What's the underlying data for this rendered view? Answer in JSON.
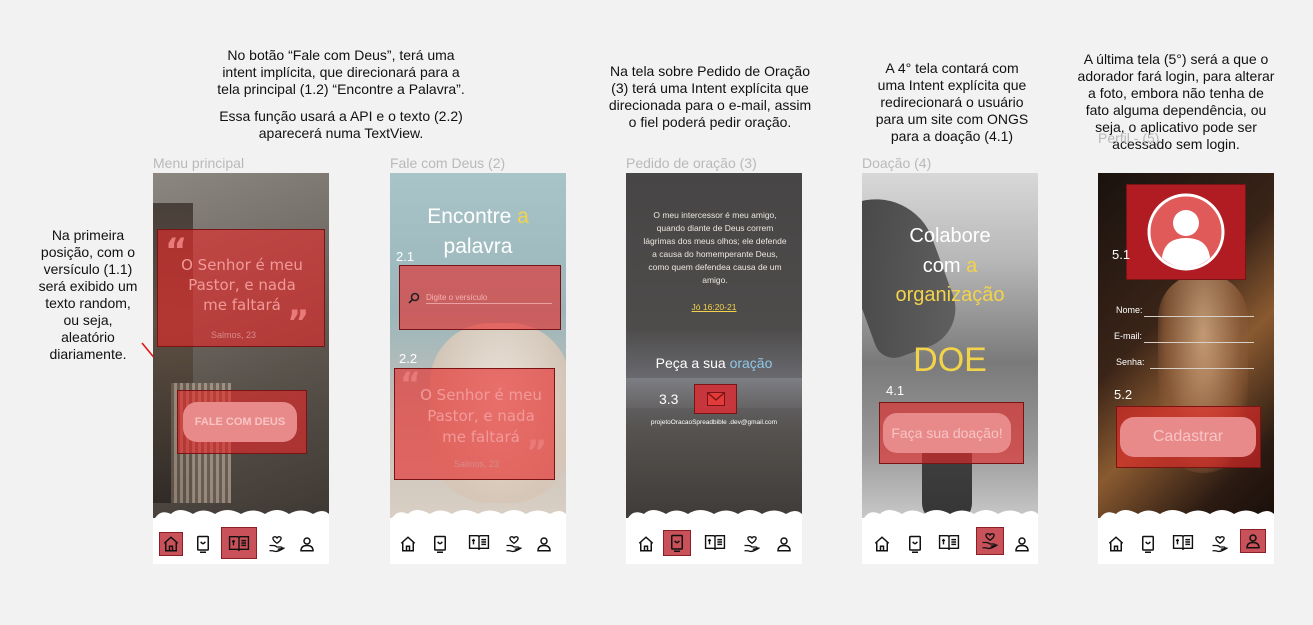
{
  "notes": {
    "top_1": "No botão “Fale com Deus”, terá uma\nintent   implícita, que direcionará para a\ntela principal (1.2) “Encontre a Palavra”.",
    "top_1b": "Essa função usará a API e o texto (2.2)\naparecerá numa TextView.",
    "top_3": "Na tela sobre Pedido de Oração\n(3) terá uma Intent explícita que\ndirecionada para o e-mail, assim\no fiel poderá pedir oração.",
    "top_4": "A 4° tela contará com\numa Intent explícita que\nredirecionará o usuário\npara um site com ONGS\npara a doação (4.1)",
    "top_5": "A última tela (5°) será a que o\nadorador fará login, para alterar\na foto, embora não tenha de\nfato alguma dependência, ou\nseja, o aplicativo pode ser\nacessado sem login.",
    "left": "Na primeira\nposição, com o\nversículo (1.1)\nserá exibido um\ntexto random,\nou seja,\naleatório\ndiariamente."
  },
  "frames": {
    "f1": "Menu principal",
    "f2": "Fale com Deus (2)",
    "f3": "Pedido de oração (3)",
    "f4": "Doação (4)",
    "f5": "Perfil - (5)"
  },
  "screen1": {
    "verse": "O Senhor é meu Pastor, e nada me faltará",
    "ref": "Salmos, 23",
    "button": "FALE COM DEUS"
  },
  "screen2": {
    "title_a": "Encontre ",
    "title_b": "a",
    "title_c": "palavra",
    "label_21": "2.1",
    "label_22": "2.2",
    "search_placeholder": "Digite o versículo",
    "verse": "O Senhor é meu Pastor, e nada me faltará",
    "ref": "Salmos, 23"
  },
  "screen3": {
    "quote": "O meu intercessor é meu amigo, quando diante de Deus correm lágrimas dos meus olhos; ele defende a causa do homemperante Deus, como quem defendea causa de um amigo.",
    "ref": "Jó 16:20-21",
    "cta_a": "Peça a sua ",
    "cta_b": "oração",
    "label_33": "3.3",
    "email": "projetoOracaoSpreadbible .dev@gmail.com"
  },
  "screen4": {
    "line1": "Colabore",
    "line2a": "com ",
    "line2b": "a",
    "line3": "organização",
    "doe": "DOE",
    "label_41": "4.1",
    "button": "Faça sua doação!"
  },
  "screen5": {
    "label_51": "5.1",
    "label_52": "5.2",
    "name_label": "Nome:",
    "email_label": "E-mail:",
    "password_label": "Senha:",
    "button": "Cadastrar"
  },
  "colors": {
    "highlight": "#e62828",
    "accent_yellow": "#f3d34a",
    "accent_blue": "#8ec8e8"
  },
  "icons": [
    "home-icon",
    "prayer-card-icon",
    "bible-icon",
    "hand-heart-icon",
    "user-icon"
  ]
}
